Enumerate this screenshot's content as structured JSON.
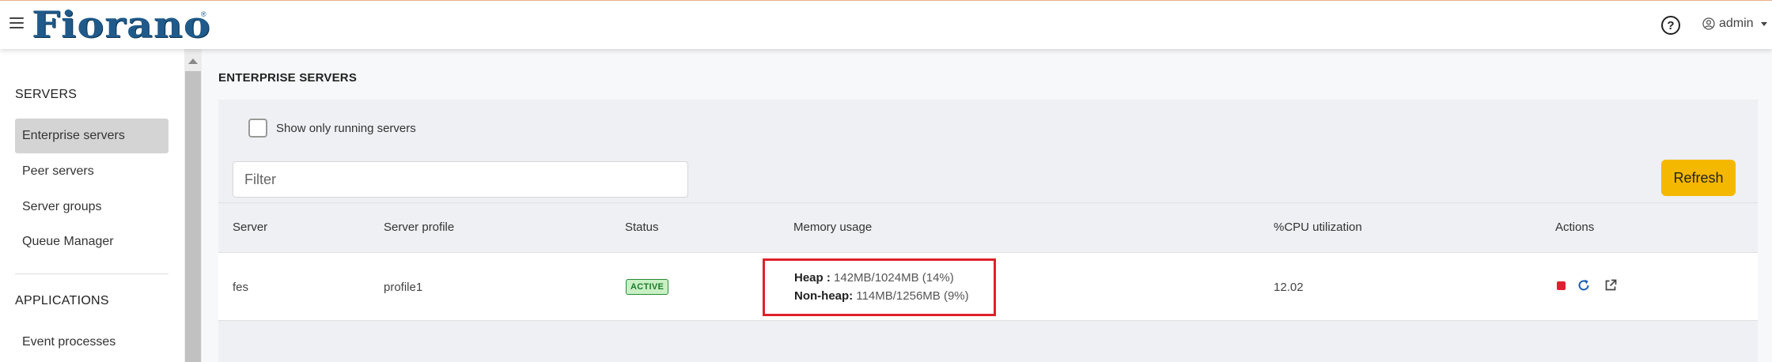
{
  "app": {
    "logo_text": "Fiorano",
    "logo_mark": "®",
    "user": "admin"
  },
  "sidebar": {
    "sections": [
      {
        "title": "SERVERS",
        "items": [
          "Enterprise servers",
          "Peer servers",
          "Server groups",
          "Queue Manager"
        ]
      },
      {
        "title": "APPLICATIONS",
        "items": [
          "Event processes"
        ]
      }
    ],
    "active_item": "Enterprise servers"
  },
  "main": {
    "title": "ENTERPRISE SERVERS",
    "show_running_label": "Show only running servers",
    "show_running_checked": false,
    "filter_placeholder": "Filter",
    "refresh_label": "Refresh",
    "columns": [
      "Server",
      "Server profile",
      "Status",
      "Memory usage",
      "%CPU utilization",
      "Actions"
    ],
    "rows": [
      {
        "server": "fes",
        "profile": "profile1",
        "status": "ACTIVE",
        "heap_label": "Heap :",
        "heap_value": " 142MB/1024MB (14%)",
        "nonheap_label": "Non-heap:",
        "nonheap_value": " 114MB/1256MB (9%)",
        "cpu": "12.02",
        "actions": [
          "stop-icon",
          "restart-icon",
          "open-external-icon"
        ]
      }
    ]
  },
  "colors": {
    "accent": "#f5b800",
    "logo": "#1f5a8a",
    "status_active": "#1e7a2a",
    "highlight": "#e0202a",
    "stop": "#e02030",
    "link": "#1a5fb4"
  }
}
